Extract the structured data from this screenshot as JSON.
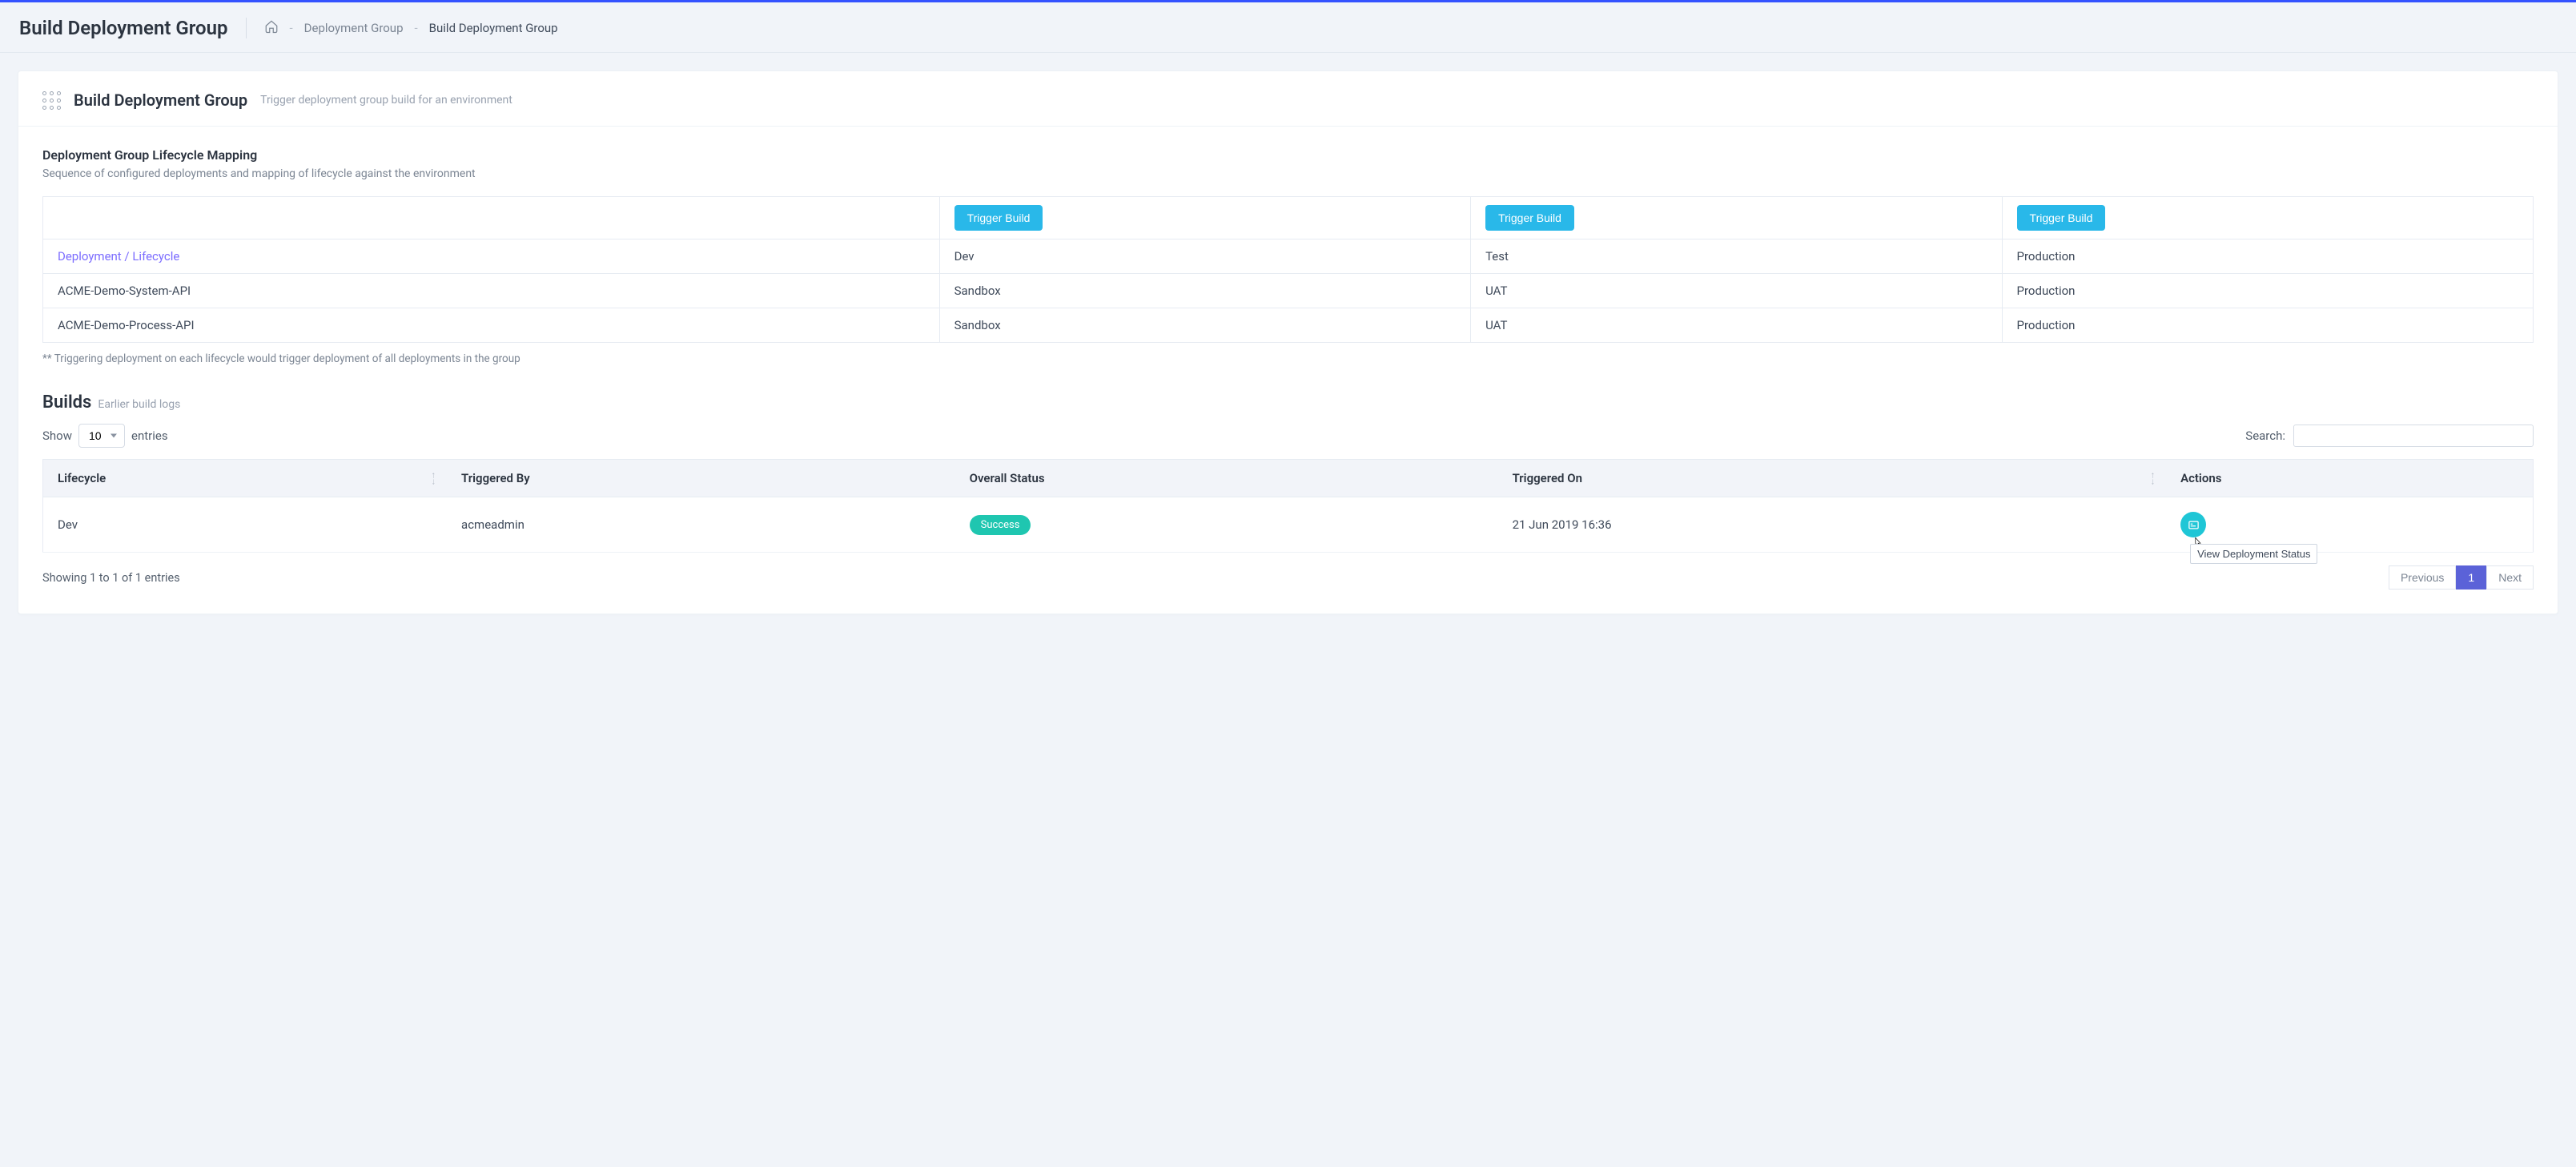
{
  "header": {
    "page_title": "Build Deployment Group",
    "breadcrumb": {
      "item1": "Deployment Group",
      "current": "Build Deployment Group"
    }
  },
  "card": {
    "title": "Build Deployment Group",
    "subtitle": "Trigger deployment group build for an environment"
  },
  "lifecycle": {
    "title": "Deployment Group Lifecycle Mapping",
    "desc": "Sequence of configured deployments and mapping of lifecycle against the environment",
    "trigger_label": "Trigger Build",
    "header_label": "Deployment / Lifecycle",
    "envs": [
      "Dev",
      "Test",
      "Production"
    ],
    "rows": [
      {
        "name": "ACME-Demo-System-API",
        "cells": [
          "Sandbox",
          "UAT",
          "Production"
        ]
      },
      {
        "name": "ACME-Demo-Process-API",
        "cells": [
          "Sandbox",
          "UAT",
          "Production"
        ]
      }
    ],
    "footnote": "** Triggering deployment on each lifecycle would trigger deployment of all deployments in the group"
  },
  "builds": {
    "title": "Builds",
    "subtitle": "Earlier build logs",
    "show_label_pre": "Show",
    "show_label_post": "entries",
    "entries_value": "10",
    "search_label": "Search:",
    "search_value": "",
    "columns": {
      "c0": "Lifecycle",
      "c1": "Triggered By",
      "c2": "Overall Status",
      "c3": "Triggered On",
      "c4": "Actions"
    },
    "rows": [
      {
        "lifecycle": "Dev",
        "triggered_by": "acmeadmin",
        "status": "Success",
        "triggered_on": "21 Jun 2019 16:36"
      }
    ],
    "tooltip": "View Deployment Status",
    "footer_info": "Showing 1 to 1 of 1 entries",
    "pagination": {
      "prev": "Previous",
      "page": "1",
      "next": "Next"
    }
  }
}
